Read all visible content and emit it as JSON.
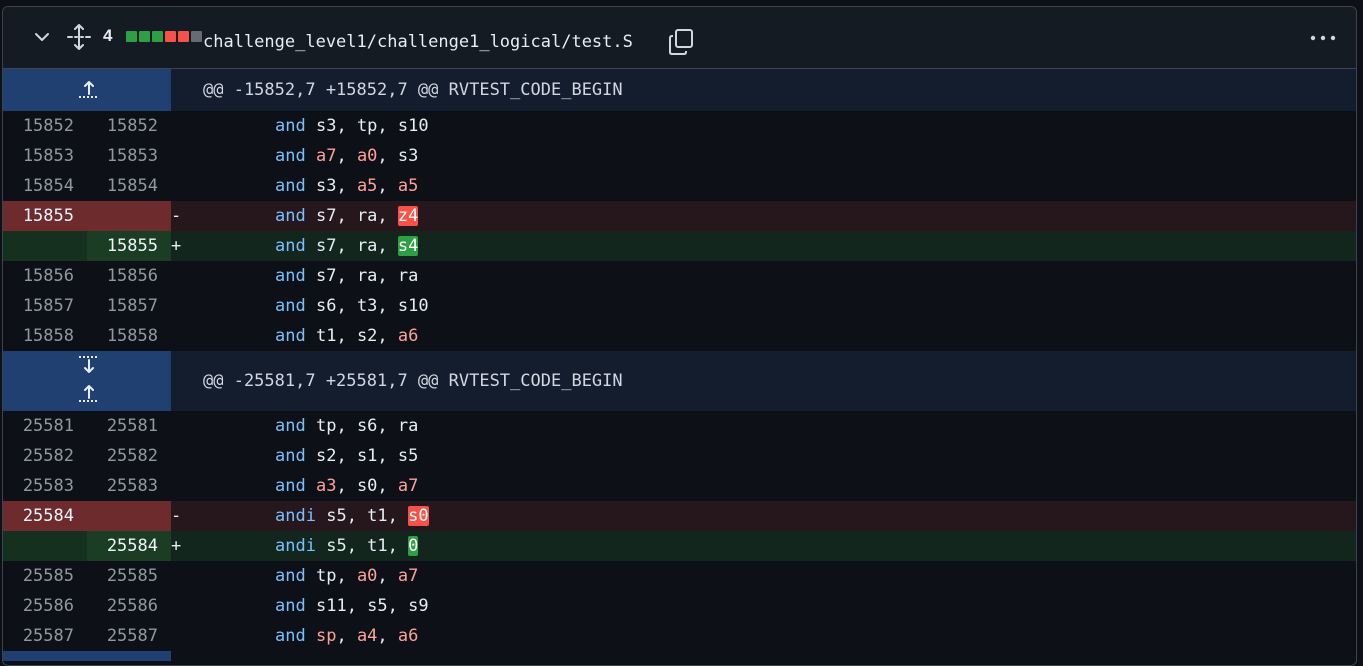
{
  "header": {
    "changed_count": "4",
    "diffstat_colors": [
      "#2ea043",
      "#2ea043",
      "#2ea043",
      "#f85149",
      "#f85149",
      "#656c76"
    ],
    "file_path": "challenge_level1/challenge1_logical/test.S",
    "icons": [
      "chevron-down-icon",
      "unfold-icon",
      "copy-icon",
      "kebab-horizontal-icon"
    ]
  },
  "hunks": [
    {
      "header": "@@ -15852,7 +15852,7 @@ RVTEST_CODE_BEGIN",
      "lines": [
        {
          "type": "ctx",
          "old": "15852",
          "new": "15852",
          "sign": "",
          "op": "and",
          "args": [
            {
              "t": "s3",
              "hl": ""
            },
            {
              "t": "tp",
              "hl": ""
            },
            {
              "t": "s10",
              "hl": ""
            }
          ]
        },
        {
          "type": "ctx",
          "old": "15853",
          "new": "15853",
          "sign": "",
          "op": "and",
          "args": [
            {
              "t": "a7",
              "hl": "reg"
            },
            {
              "t": "a0",
              "hl": "reg"
            },
            {
              "t": "s3",
              "hl": ""
            }
          ]
        },
        {
          "type": "ctx",
          "old": "15854",
          "new": "15854",
          "sign": "",
          "op": "and",
          "args": [
            {
              "t": "s3",
              "hl": ""
            },
            {
              "t": "a5",
              "hl": "reg"
            },
            {
              "t": "a5",
              "hl": "reg"
            }
          ]
        },
        {
          "type": "del",
          "old": "15855",
          "new": "",
          "sign": "-",
          "op": "and",
          "args": [
            {
              "t": "s7",
              "hl": ""
            },
            {
              "t": "ra",
              "hl": ""
            },
            {
              "t": "z4",
              "hl": "del"
            }
          ]
        },
        {
          "type": "add",
          "old": "",
          "new": "15855",
          "sign": "+",
          "op": "and",
          "args": [
            {
              "t": "s7",
              "hl": ""
            },
            {
              "t": "ra",
              "hl": ""
            },
            {
              "t": "s4",
              "hl": "add"
            }
          ]
        },
        {
          "type": "ctx",
          "old": "15856",
          "new": "15856",
          "sign": "",
          "op": "and",
          "args": [
            {
              "t": "s7",
              "hl": ""
            },
            {
              "t": "ra",
              "hl": ""
            },
            {
              "t": "ra",
              "hl": ""
            }
          ]
        },
        {
          "type": "ctx",
          "old": "15857",
          "new": "15857",
          "sign": "",
          "op": "and",
          "args": [
            {
              "t": "s6",
              "hl": ""
            },
            {
              "t": "t3",
              "hl": ""
            },
            {
              "t": "s10",
              "hl": ""
            }
          ]
        },
        {
          "type": "ctx",
          "old": "15858",
          "new": "15858",
          "sign": "",
          "op": "and",
          "args": [
            {
              "t": "t1",
              "hl": ""
            },
            {
              "t": "s2",
              "hl": ""
            },
            {
              "t": "a6",
              "hl": "reg"
            }
          ]
        }
      ]
    },
    {
      "header": "@@ -25581,7 +25581,7 @@ RVTEST_CODE_BEGIN",
      "lines": [
        {
          "type": "ctx",
          "old": "25581",
          "new": "25581",
          "sign": "",
          "op": "and",
          "args": [
            {
              "t": "tp",
              "hl": ""
            },
            {
              "t": "s6",
              "hl": ""
            },
            {
              "t": "ra",
              "hl": ""
            }
          ]
        },
        {
          "type": "ctx",
          "old": "25582",
          "new": "25582",
          "sign": "",
          "op": "and",
          "args": [
            {
              "t": "s2",
              "hl": ""
            },
            {
              "t": "s1",
              "hl": ""
            },
            {
              "t": "s5",
              "hl": ""
            }
          ]
        },
        {
          "type": "ctx",
          "old": "25583",
          "new": "25583",
          "sign": "",
          "op": "and",
          "args": [
            {
              "t": "a3",
              "hl": "reg"
            },
            {
              "t": "s0",
              "hl": ""
            },
            {
              "t": "a7",
              "hl": "reg"
            }
          ]
        },
        {
          "type": "del",
          "old": "25584",
          "new": "",
          "sign": "-",
          "op": "andi",
          "args": [
            {
              "t": "s5",
              "hl": ""
            },
            {
              "t": "t1",
              "hl": ""
            },
            {
              "t": "s0",
              "hl": "del"
            }
          ]
        },
        {
          "type": "add",
          "old": "",
          "new": "25584",
          "sign": "+",
          "op": "andi",
          "args": [
            {
              "t": "s5",
              "hl": ""
            },
            {
              "t": "t1",
              "hl": ""
            },
            {
              "t": "0",
              "hl": "add"
            }
          ]
        },
        {
          "type": "ctx",
          "old": "25585",
          "new": "25585",
          "sign": "",
          "op": "and",
          "args": [
            {
              "t": "tp",
              "hl": ""
            },
            {
              "t": "a0",
              "hl": "reg"
            },
            {
              "t": "a7",
              "hl": "reg"
            }
          ]
        },
        {
          "type": "ctx",
          "old": "25586",
          "new": "25586",
          "sign": "",
          "op": "and",
          "args": [
            {
              "t": "s11",
              "hl": ""
            },
            {
              "t": "s5",
              "hl": ""
            },
            {
              "t": "s9",
              "hl": ""
            }
          ]
        },
        {
          "type": "ctx",
          "old": "25587",
          "new": "25587",
          "sign": "",
          "op": "and",
          "args": [
            {
              "t": "sp",
              "hl": "reg"
            },
            {
              "t": "a4",
              "hl": "reg"
            },
            {
              "t": "a6",
              "hl": "reg"
            }
          ]
        }
      ]
    }
  ]
}
